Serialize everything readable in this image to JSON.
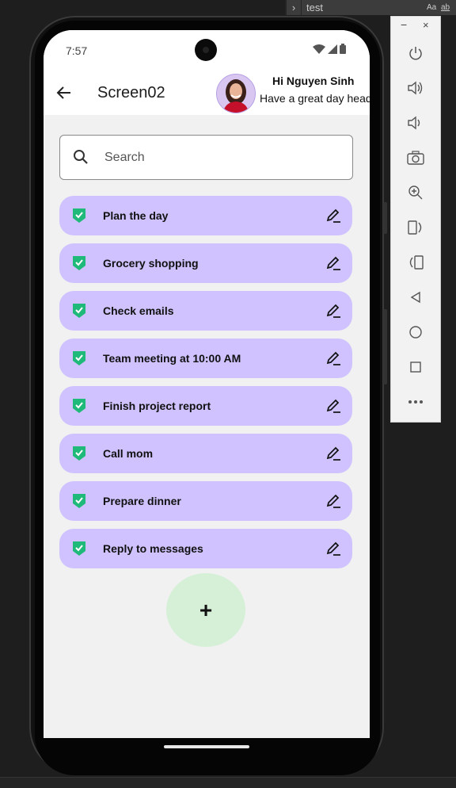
{
  "ide": {
    "chevron": "›",
    "search_text": "test",
    "opt_case": "Aa",
    "opt_word": "ab"
  },
  "status_bar": {
    "time": "7:57"
  },
  "app_bar": {
    "title": "Screen02",
    "greeting": "Hi Nguyen Sinh",
    "subtitle": "Have a great day head"
  },
  "search": {
    "placeholder": "Search"
  },
  "todos": [
    {
      "label": "Plan the day"
    },
    {
      "label": "Grocery shopping"
    },
    {
      "label": "Check emails"
    },
    {
      "label": "Team meeting at 10:00 AM"
    },
    {
      "label": "Finish project report"
    },
    {
      "label": "Call mom"
    },
    {
      "label": "Prepare dinner"
    },
    {
      "label": "Reply to messages"
    }
  ],
  "fab": {
    "label": "+"
  },
  "emulator_panel": {
    "minimize": "−",
    "close": "×",
    "icons": [
      "power-icon",
      "volume-up-icon",
      "volume-down-icon",
      "camera-icon",
      "zoom-icon",
      "rotate-left-icon",
      "rotate-right-icon",
      "back-icon",
      "home-icon",
      "overview-icon",
      "more-icon"
    ]
  },
  "colors": {
    "todo_bg": "#cfc2ff",
    "check_green": "#1fb97a",
    "fab_bg": "#d6f0d8",
    "screen_bg": "#f1f1f1"
  }
}
